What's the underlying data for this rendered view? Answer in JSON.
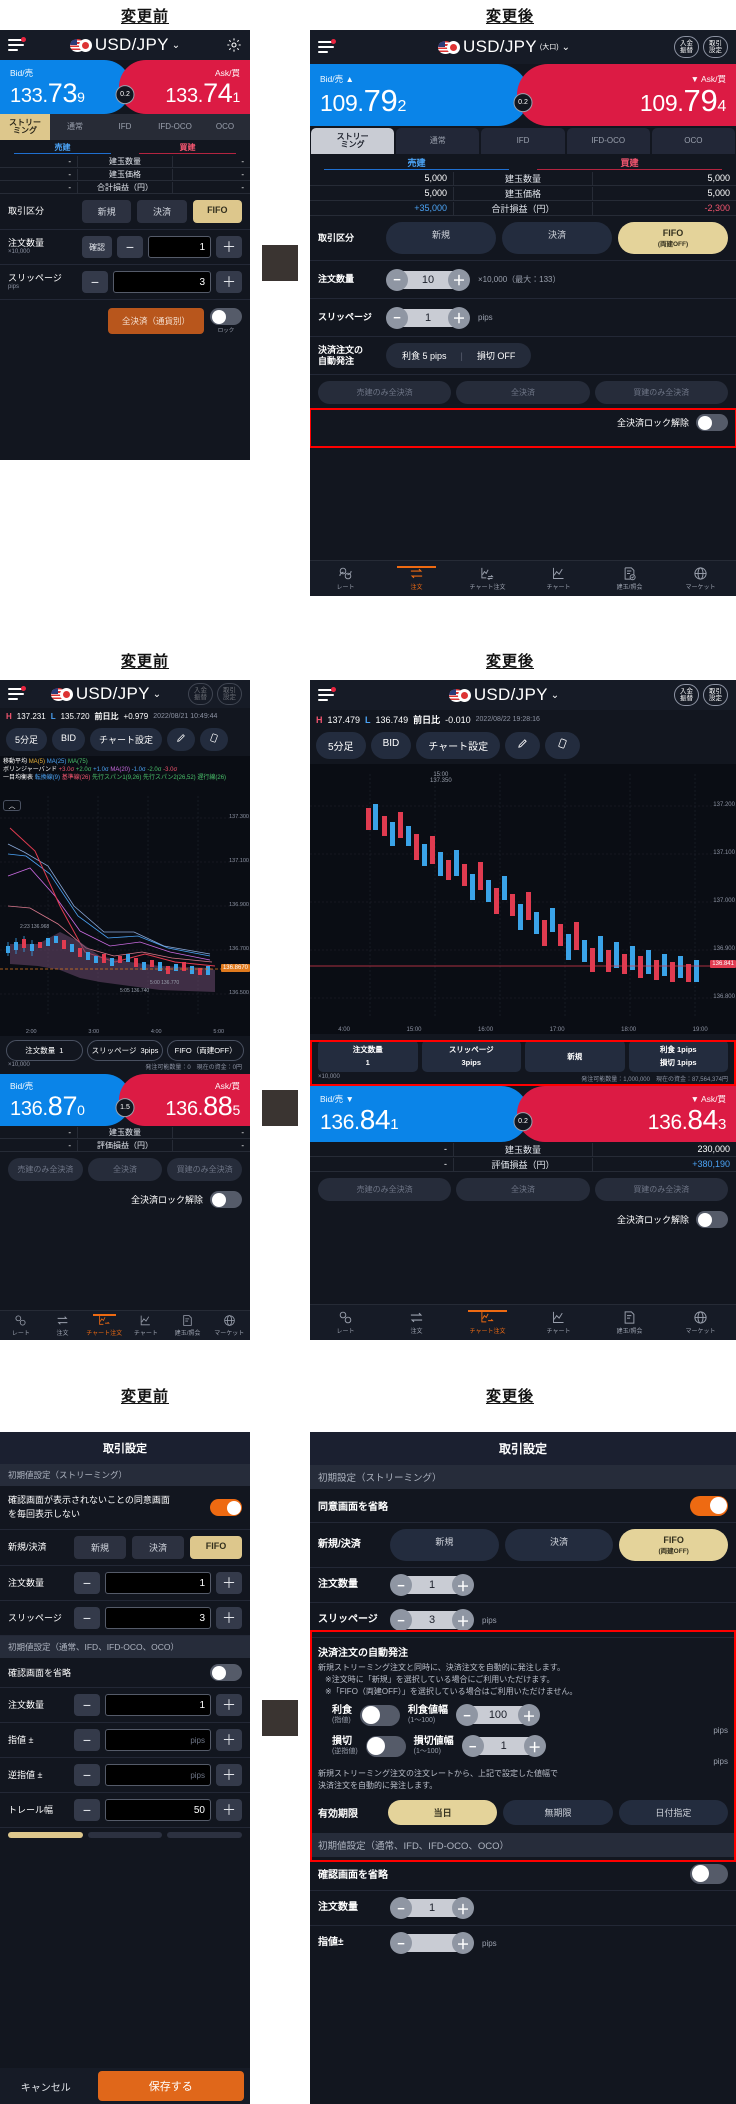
{
  "captions": {
    "before": "変更前",
    "after": "変更後"
  },
  "common": {
    "pair": "USD/JPY",
    "pair_suffix": "(大口)",
    "bid_label": "Bid/売",
    "ask_label": "Ask/買",
    "up_arrow": "▲",
    "down_arrow": "▼",
    "tabs": [
      "ストリー\nミング",
      "通常",
      "IFD",
      "IFD-OCO",
      "OCO"
    ],
    "col_sell": "売建",
    "col_buy": "買建",
    "rows": [
      "建玉数量",
      "建玉価格",
      "合計損益（円）"
    ],
    "deposit_btn": "入金\n振替",
    "settings_btn": "取引\n設定",
    "bottom_nav": [
      "レート",
      "注文",
      "チャート注文",
      "チャート",
      "建玉/照会",
      "マーケット"
    ],
    "lock_release": "全決済ロック解除",
    "close_all_sell": "売建のみ全決済",
    "close_all": "全決済",
    "close_all_buy": "買建のみ全決済"
  },
  "panel1_before": {
    "bid": {
      "int": "133.",
      "big": "73",
      "small": "9"
    },
    "ask": {
      "int": "133.",
      "big": "74",
      "small": "1"
    },
    "spread": "0.2",
    "table": {
      "sell": [
        "-",
        "-",
        "-"
      ],
      "buy": [
        "-",
        "-",
        "-"
      ]
    },
    "torihiki_kubun_label": "取引区分",
    "kubun": [
      "新規",
      "決済",
      "FIFO"
    ],
    "kubun_selected": "FIFO",
    "qty_label": "注文数量",
    "qty_unit": "×10,000",
    "qty_confirm": "確認",
    "qty_value": "1",
    "slip_label": "スリッページ",
    "slip_unit": "pips",
    "slip_value": "3",
    "close_all_cur": "全決済（通貨別）",
    "lock_label": "ロック"
  },
  "panel1_after": {
    "bid": {
      "int": "109.",
      "big": "79",
      "small": "2"
    },
    "ask": {
      "int": "109.",
      "big": "79",
      "small": "4"
    },
    "spread": "0.2",
    "table": {
      "sell": [
        "5,000",
        "5,000",
        "+35,000"
      ],
      "buy": [
        "5,000",
        "5,000",
        "-2,300"
      ]
    },
    "torihiki_kubun_label": "取引区分",
    "kubun": [
      "新規",
      "決済",
      "FIFO"
    ],
    "kubun_sub": "(両建OFF)",
    "qty_label": "注文数量",
    "qty_value": "10",
    "qty_unit": "×10,000（最大：133）",
    "slip_label": "スリッページ",
    "slip_value": "1",
    "slip_unit": "pips",
    "auto_label": "決済注文の\n自動発注",
    "auto_profit": "利食 5 pips",
    "auto_loss": "損切 OFF"
  },
  "panel2_before": {
    "high_label": "H",
    "high": "137.231",
    "low_label": "L",
    "low": "135.720",
    "change_label": "前日比",
    "change": "+0.979",
    "time": "2022/08/21 10:49:44",
    "chart_btns": [
      "5分足",
      "BID",
      "チャート設定"
    ],
    "indicators": {
      "ma_label": "移動平均",
      "ma": [
        "MA(5)",
        "MA(25)",
        "MA(75)"
      ],
      "bb_label": "ボリンジャーバンド",
      "bb": [
        "+3.0σ",
        "+2.0σ",
        "+1.0σ",
        "MA(20)",
        "-1.0σ",
        "-2.0σ",
        "-3.0σ"
      ],
      "ichimoku_label": "一目均衡表",
      "ichimoku": [
        "転換線(9)",
        "基準線(26)",
        "先行スパン1(9,26)",
        "先行スパン2(26,52)",
        "遅行線(26)"
      ]
    },
    "y_ticks": [
      "137.300",
      "137.100",
      "136.900",
      "136.700",
      "136.500"
    ],
    "x_ticks": [
      "2:00",
      "3:00",
      "4:00",
      "5:00"
    ],
    "candle_labels": [
      "2:23 136.968",
      "5:05 136.740",
      "5:00 136.770"
    ],
    "cur_price": "136.8670",
    "order_chips": [
      {
        "label": "注文数量",
        "value": "1"
      },
      {
        "label": "スリッページ",
        "value": "3pips"
      },
      {
        "label": "FIFO（両建OFF）",
        "value": ""
      }
    ],
    "qty_unit": "×10,000",
    "available": "発注可能数量：0　現在の資金：0円",
    "bid": {
      "int": "136.",
      "big": "87",
      "small": "0"
    },
    "ask": {
      "int": "136.",
      "big": "88",
      "small": "5"
    },
    "spread": "1.5",
    "rows": [
      "建玉数量",
      "評価損益（円）"
    ],
    "sell_vals": [
      "-",
      "-"
    ],
    "buy_vals": [
      "-",
      "-"
    ]
  },
  "panel2_after": {
    "high_label": "H",
    "high": "137.479",
    "low_label": "L",
    "low": "136.749",
    "change_label": "前日比",
    "change": "-0.010",
    "time": "2022/08/22 19:28:16",
    "chart_btns": [
      "5分足",
      "BID",
      "チャート設定"
    ],
    "y_ticks": [
      "137.200",
      "137.100",
      "137.000",
      "136.900",
      "136.800"
    ],
    "x_ticks": [
      "4:00",
      "15:00",
      "16:00",
      "17:00",
      "18:00",
      "19:00"
    ],
    "peak_label": "15:00\n137.350",
    "cur_price": "136.841",
    "order_chips": [
      {
        "label": "注文数量",
        "value": "1"
      },
      {
        "label": "スリッページ",
        "value": "3pips"
      },
      {
        "label": "新規",
        "value": ""
      },
      {
        "label": "利食 1pips",
        "value": "損切 1pips"
      }
    ],
    "qty_unit": "×10,000",
    "available": "発注可能数量：1,000,000　現在の資金：87,564,374円",
    "bid": {
      "int": "136.",
      "big": "84",
      "small": "1"
    },
    "ask": {
      "int": "136.",
      "big": "84",
      "small": "3"
    },
    "spread": "0.2",
    "rows": [
      "建玉数量",
      "評価損益（円）"
    ],
    "sell_vals": [
      "-",
      "-"
    ],
    "buy_vals": [
      "230,000",
      "+380,190"
    ]
  },
  "panel3_before": {
    "title": "取引設定",
    "section1": "初期値設定（ストリーミング）",
    "consent_text": "確認画面が表示されないことの同意画面\nを毎回表示しない",
    "consent_on": true,
    "shinki_label": "新規/決済",
    "shinki": [
      "新規",
      "決済",
      "FIFO"
    ],
    "qty_label": "注文数量",
    "qty_value": "1",
    "slip_label": "スリッページ",
    "slip_value": "3",
    "section2": "初期値設定（通常、IFD、IFD-OCO、OCO）",
    "omit_label": "確認画面を省略",
    "omit_on": false,
    "qty2_label": "注文数量",
    "qty2_value": "1",
    "sashine_label": "指値 ±",
    "sashine_unit": "pips",
    "gyaku_label": "逆指値 ±",
    "gyaku_unit": "pips",
    "trail_label": "トレール幅",
    "trail_value": "50",
    "cancel": "キャンセル",
    "save": "保存する"
  },
  "panel3_after": {
    "title": "取引設定",
    "section1": "初期設定（ストリーミング）",
    "consent_label": "同意画面を省略",
    "consent_on": true,
    "shinki_label": "新規/決済",
    "shinki": [
      "新規",
      "決済",
      "FIFO"
    ],
    "shinki_sub": "(両建OFF)",
    "qty_label": "注文数量",
    "qty_value": "1",
    "slip_label": "スリッページ",
    "slip_value": "3",
    "slip_unit": "pips",
    "auto": {
      "title": "決済注文の自動発注",
      "desc1": "新規ストリーミング注文と同時に、決済注文を自動的に発注します。",
      "desc2": "※注文時に「新規」を選択している場合にご利用いただけます。",
      "desc3": "※「FIFO（両建OFF）」を選択している場合はご利用いただけません。",
      "profit_label": "利食",
      "profit_sub": "(指値)",
      "profit_on": false,
      "profit_val_label": "利食値幅",
      "profit_val_range": "(1〜100)",
      "profit_value": "100",
      "loss_label": "損切",
      "loss_sub": "(逆指値)",
      "loss_on": false,
      "loss_val_label": "損切値幅",
      "loss_val_range": "(1〜100)",
      "loss_value": "1",
      "unit": "pips",
      "note": "新規ストリーミング注文の注文レートから、上記で設定した値幅で\n決済注文を自動的に発注します。",
      "expiry_label": "有効期限",
      "expiry": [
        "当日",
        "無期限",
        "日付指定"
      ],
      "expiry_selected": "当日"
    },
    "section2": "初期値設定（通常、IFD、IFD-OCO、OCO）",
    "omit_label": "確認画面を省略",
    "omit_on": false,
    "qty2_label": "注文数量",
    "qty2_value": "1",
    "sashine_label": "指値±",
    "sashine_unit": "pips"
  },
  "colors": {
    "bid": "#0a84e8",
    "ask": "#dc1b44",
    "accent_gold": "#ddc78c",
    "accent_orange": "#ee6a12",
    "highlight": "#ff0000",
    "bg": "#12161f"
  }
}
